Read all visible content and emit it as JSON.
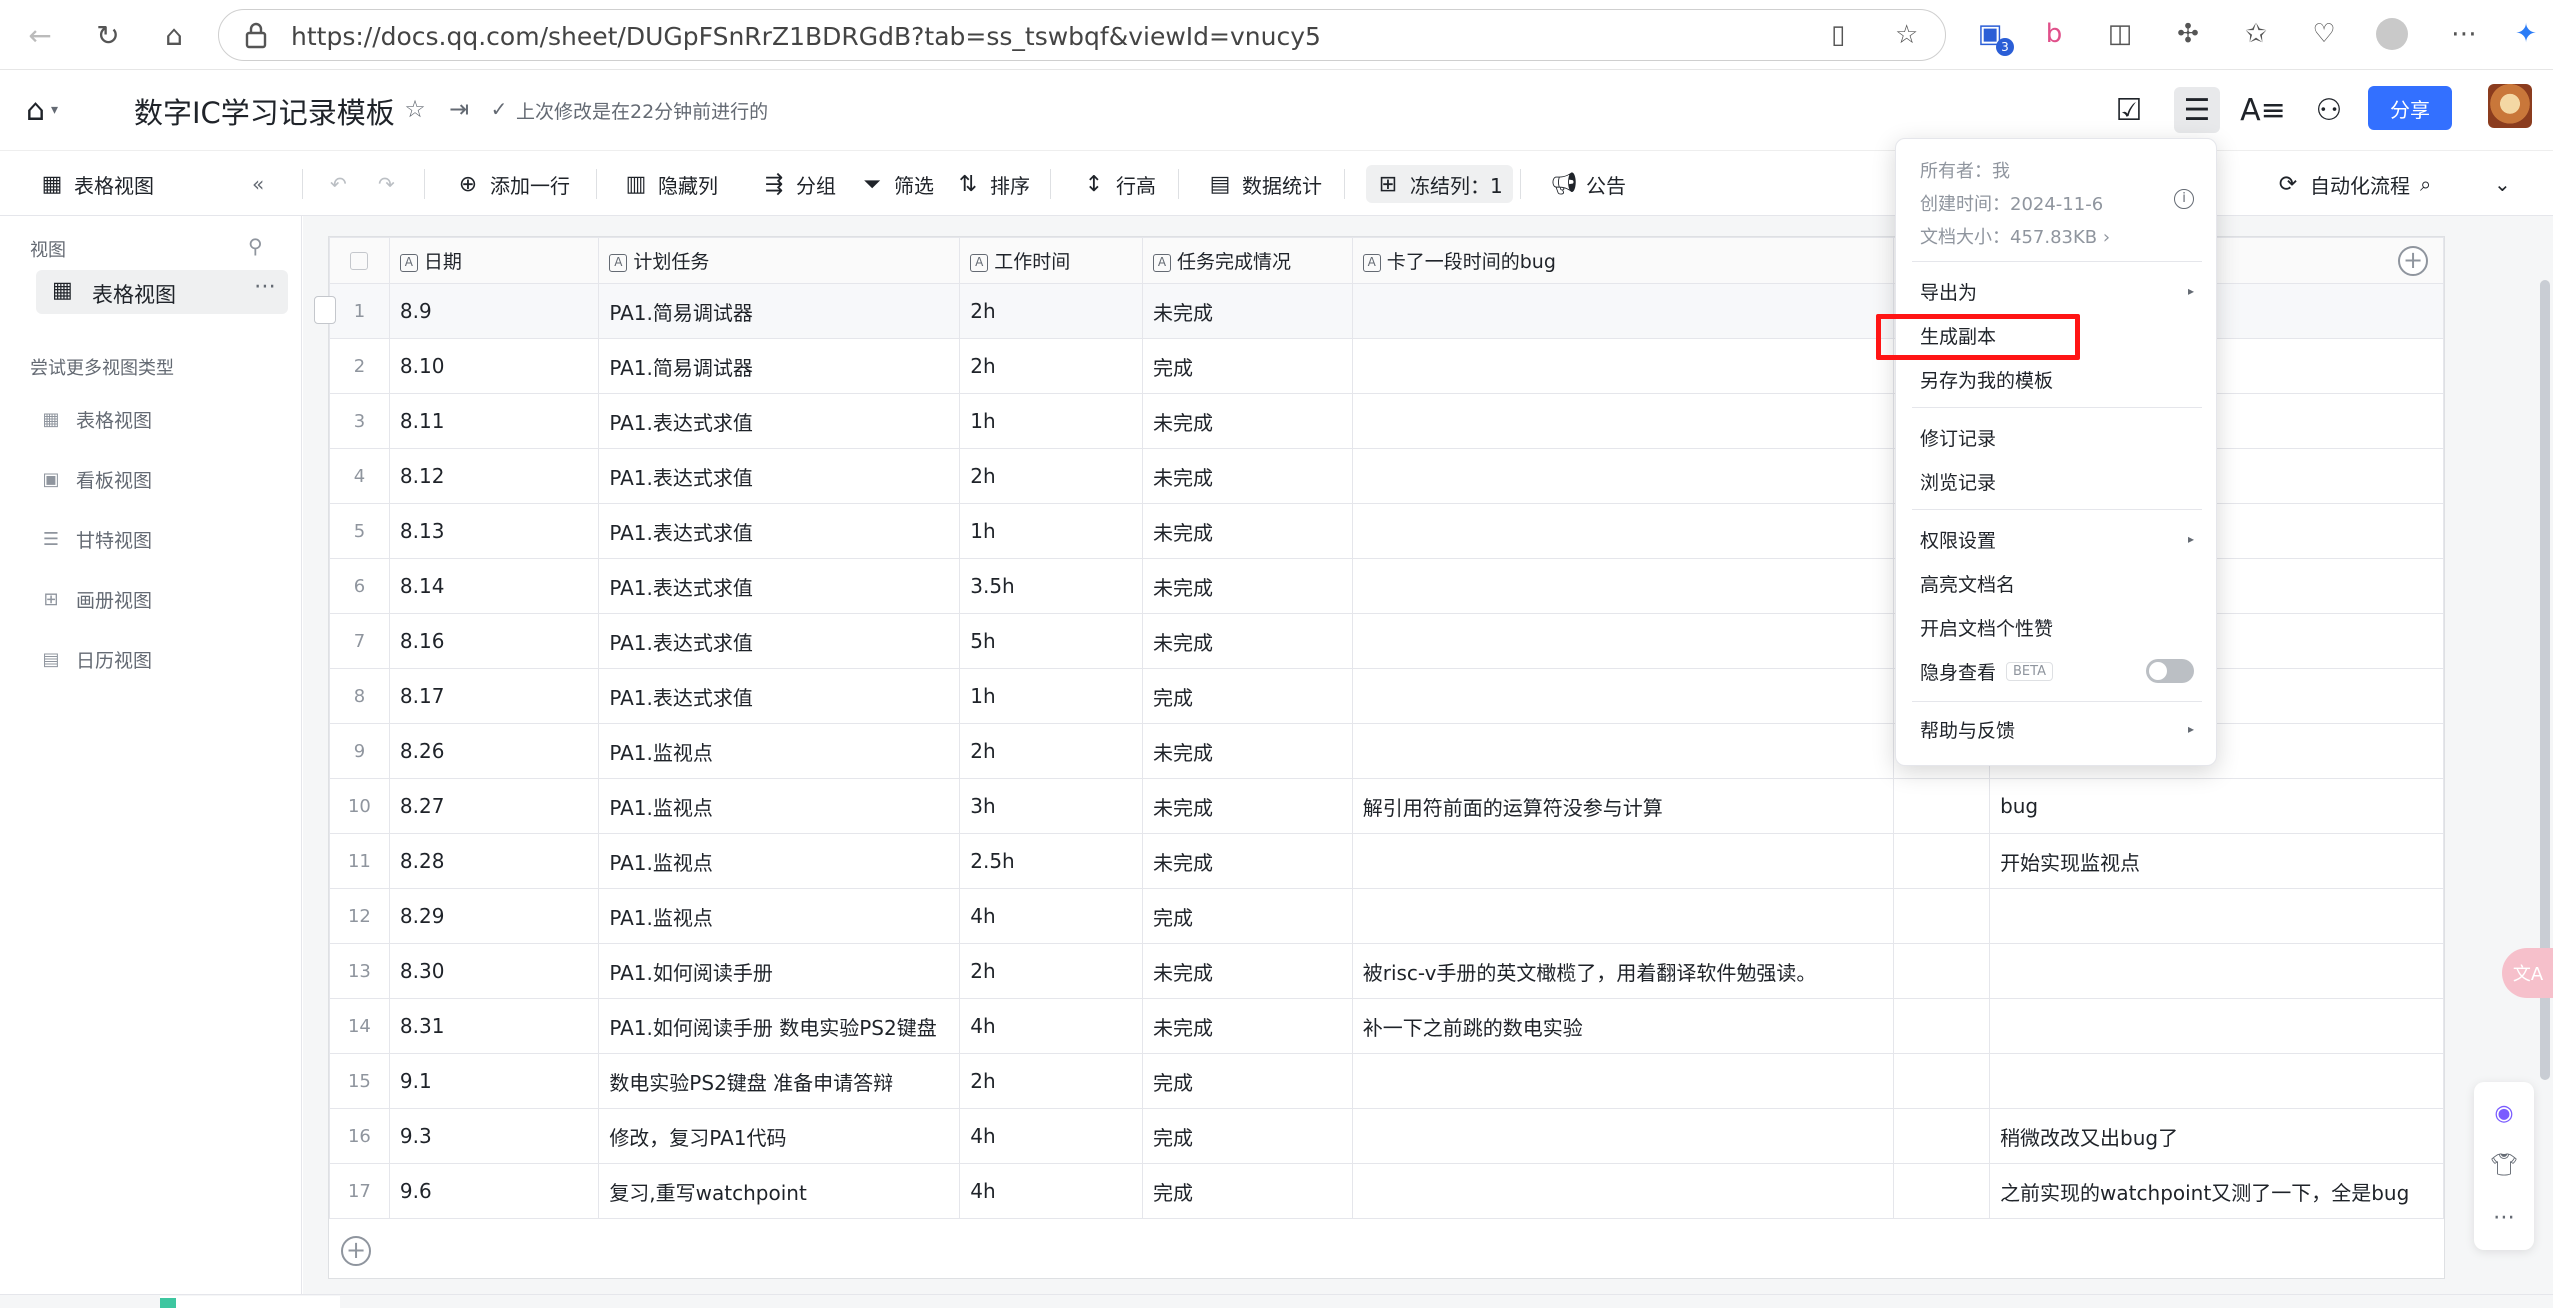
{
  "browser": {
    "url": "https://docs.qq.com/sheet/DUGpFSnRrZ1BDRGdB?tab=ss_tswbqf&viewId=vnucy5",
    "ext_badge": "3"
  },
  "header": {
    "title": "数字IC学习记录模板",
    "last_edit": "上次修改是在22分钟前进行的",
    "share_label": "分享"
  },
  "toolbar": {
    "view_label": "表格视图",
    "add_row": "添加一行",
    "hide_cols": "隐藏列",
    "group": "分组",
    "filter": "筛选",
    "sort": "排序",
    "row_height": "行高",
    "stats": "数据统计",
    "freeze": "冻结列：1",
    "notice": "公告",
    "automation": "自动化流程"
  },
  "sidebar": {
    "section_label": "视图",
    "active_view": "表格视图",
    "more_label": "尝试更多视图类型",
    "view_types": [
      {
        "label": "表格视图",
        "icon": "table-icon"
      },
      {
        "label": "看板视图",
        "icon": "kanban-icon"
      },
      {
        "label": "甘特视图",
        "icon": "gantt-icon"
      },
      {
        "label": "画册视图",
        "icon": "gallery-icon"
      },
      {
        "label": "日历视图",
        "icon": "calendar-icon"
      }
    ]
  },
  "table": {
    "columns": [
      "日期",
      "计划任务",
      "工作时间",
      "任务完成情况",
      "卡了一段时间的bug",
      "",
      ""
    ],
    "rows": [
      {
        "n": "1",
        "date": "8.9",
        "task": "PA1.简易调试器",
        "time": "2h",
        "status": "未完成",
        "bug": "",
        "c6": "",
        "note": ""
      },
      {
        "n": "2",
        "date": "8.10",
        "task": "PA1.简易调试器",
        "time": "2h",
        "status": "完成",
        "bug": "",
        "c6": "",
        "note": ""
      },
      {
        "n": "3",
        "date": "8.11",
        "task": "PA1.表达式求值",
        "time": "1h",
        "status": "未完成",
        "bug": "",
        "c6": "",
        "note": ""
      },
      {
        "n": "4",
        "date": "8.12",
        "task": "PA1.表达式求值",
        "time": "2h",
        "status": "未完成",
        "bug": "",
        "c6": "",
        "note": ""
      },
      {
        "n": "5",
        "date": "8.13",
        "task": "PA1.表达式求值",
        "time": "1h",
        "status": "未完成",
        "bug": "",
        "c6": "",
        "note": ""
      },
      {
        "n": "6",
        "date": "8.14",
        "task": "PA1.表达式求值",
        "time": "3.5h",
        "status": "未完成",
        "bug": "",
        "c6": "",
        "note": ""
      },
      {
        "n": "7",
        "date": "8.16",
        "task": "PA1.表达式求值",
        "time": "5h",
        "status": "未完成",
        "bug": "",
        "c6": "",
        "note": ""
      },
      {
        "n": "8",
        "date": "8.17",
        "task": "PA1.表达式求值",
        "time": "1h",
        "status": "完成",
        "bug": "",
        "c6": "",
        "note": ""
      },
      {
        "n": "9",
        "date": "8.26",
        "task": "PA1.监视点",
        "time": "2h",
        "status": "未完成",
        "bug": "",
        "c6": "",
        "note": ""
      },
      {
        "n": "10",
        "date": "8.27",
        "task": "PA1.监视点",
        "time": "3h",
        "status": "未完成",
        "bug": "解引用符前面的运算符没参与计算",
        "c6": "",
        "note": "bug"
      },
      {
        "n": "11",
        "date": "8.28",
        "task": "PA1.监视点",
        "time": "2.5h",
        "status": "未完成",
        "bug": "",
        "c6": "",
        "note": "开始实现监视点"
      },
      {
        "n": "12",
        "date": "8.29",
        "task": "PA1.监视点",
        "time": "4h",
        "status": "完成",
        "bug": "",
        "c6": "",
        "note": ""
      },
      {
        "n": "13",
        "date": "8.30",
        "task": "PA1.如何阅读手册",
        "time": "2h",
        "status": "未完成",
        "bug": "被risc-v手册的英文橄榄了，用着翻译软件勉强读。",
        "c6": "",
        "note": ""
      },
      {
        "n": "14",
        "date": "8.31",
        "task": "PA1.如何阅读手册 数电实验PS2键盘",
        "time": "4h",
        "status": "未完成",
        "bug": "补一下之前跳的数电实验",
        "c6": "",
        "note": ""
      },
      {
        "n": "15",
        "date": "9.1",
        "task": "数电实验PS2键盘 准备申请答辩",
        "time": "2h",
        "status": "完成",
        "bug": "",
        "c6": "",
        "note": ""
      },
      {
        "n": "16",
        "date": "9.3",
        "task": "修改，复习PA1代码",
        "time": "4h",
        "status": "完成",
        "bug": "",
        "c6": "",
        "note": "稍微改改又出bug了"
      },
      {
        "n": "17",
        "date": "9.6",
        "task": "复习,重写watchpoint",
        "time": "4h",
        "status": "完成",
        "bug": "",
        "c6": "",
        "note": "之前实现的watchpoint又测了一下，全是bug"
      }
    ]
  },
  "menu": {
    "owner": "所有者：我",
    "created": "创建时间：2024-11-6",
    "size": "文档大小：457.83KB",
    "items": {
      "export": "导出为",
      "copy": "生成副本",
      "save_template": "另存为我的模板",
      "revisions": "修订记录",
      "views": "浏览记录",
      "permissions": "权限设置",
      "highlight_name": "高亮文档名",
      "likes": "开启文档个性赞",
      "incognito": "隐身查看",
      "beta": "BETA",
      "help": "帮助与反馈"
    }
  },
  "colors": {
    "primary": "#3370ff",
    "highlight_box": "#ff1414"
  }
}
